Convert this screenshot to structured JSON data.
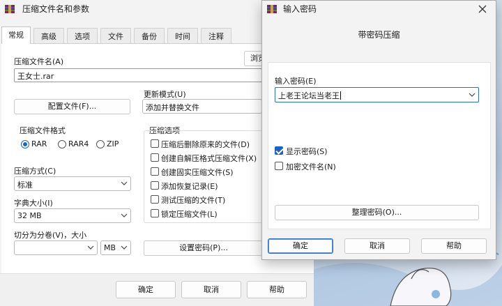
{
  "main_dialog": {
    "title": "压缩文件名和参数",
    "tabs": [
      {
        "label": "常规",
        "active": true
      },
      {
        "label": "高级",
        "active": false
      },
      {
        "label": "选项",
        "active": false
      },
      {
        "label": "文件",
        "active": false
      },
      {
        "label": "备份",
        "active": false
      },
      {
        "label": "时间",
        "active": false
      },
      {
        "label": "注释",
        "active": false
      }
    ],
    "archive_name_label": "压缩文件名(A)",
    "archive_name_value": "王女士.rar",
    "browse_label": "浏览",
    "profiles_button": "配置文件(F)...",
    "update_mode_label": "更新模式(U)",
    "update_mode_value": "添加并替换文件",
    "format_group_title": "压缩文件格式",
    "formats": [
      {
        "label": "RAR",
        "selected": true
      },
      {
        "label": "RAR4",
        "selected": false
      },
      {
        "label": "ZIP",
        "selected": false
      }
    ],
    "options_group_title": "压缩选项",
    "options": [
      {
        "label": "压缩后删除原来的文件(D)",
        "checked": false
      },
      {
        "label": "创建自解压格式压缩文件(X)",
        "checked": false
      },
      {
        "label": "创建固实压缩文件(S)",
        "checked": false
      },
      {
        "label": "添加恢复记录(E)",
        "checked": false
      },
      {
        "label": "测试压缩的文件(T)",
        "checked": false
      },
      {
        "label": "锁定压缩文件(L)",
        "checked": false
      }
    ],
    "method_label": "压缩方式(C)",
    "method_value": "标准",
    "dict_label": "字典大小(I)",
    "dict_value": "32 MB",
    "split_label": "切分为分卷(V)，大小",
    "split_value": "",
    "split_unit": "MB",
    "set_password_button": "设置密码(P)...",
    "ok_button": "确定",
    "cancel_button": "取消",
    "help_button": "帮助"
  },
  "password_dialog": {
    "title": "输入密码",
    "subtitle": "带密码压缩",
    "enter_password_label": "输入密码(E)",
    "password_value": "上老王论坛当老王",
    "show_password": {
      "label": "显示密码(S)",
      "checked": true
    },
    "encrypt_names": {
      "label": "加密文件名(N)",
      "checked": false
    },
    "organize_button": "整理密码(O)...",
    "ok_button": "确定",
    "cancel_button": "取消",
    "help_button": "帮助"
  },
  "colors": {
    "accent": "#1b62c4",
    "window_bg": "#f3f3f3"
  }
}
